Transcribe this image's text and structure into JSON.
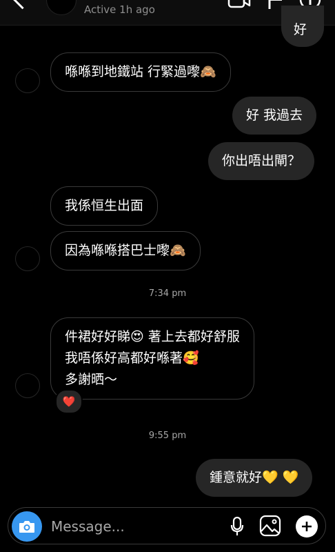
{
  "header": {
    "status": "Active 1h ago"
  },
  "messages": [
    {
      "text": "好"
    },
    {
      "text": "喺喺到地鐵站 行緊過嚟🙈"
    },
    {
      "text": "好 我過去"
    },
    {
      "text": "你出唔出閘？"
    },
    {
      "text": "我係恒生出面"
    },
    {
      "text": "因為喺喺搭巴士嚟🙈"
    },
    {
      "line1": "件裙好好睇😍 著上去都好舒服",
      "line2": "我唔係好高都好喺著🥰",
      "line3": "多謝晒～",
      "reaction": "❤️"
    },
    {
      "text": "鍾意就好💛 💛"
    }
  ],
  "timestamps": [
    "7:34 pm",
    "9:55 pm"
  ],
  "composer": {
    "placeholder": "Message..."
  },
  "colors": {
    "accent": "#3797f0",
    "outgoing_bubble": "#262626",
    "background": "#000000"
  }
}
